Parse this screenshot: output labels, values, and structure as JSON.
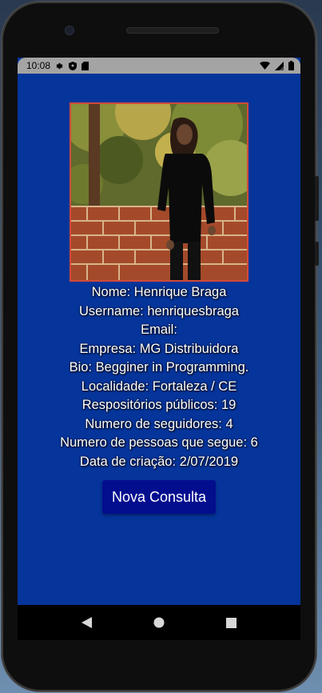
{
  "status_bar": {
    "time": "10:08",
    "left_icons": [
      "gear-icon",
      "shield-icon",
      "sd-card-icon"
    ],
    "right_icons": [
      "wifi-icon",
      "cellular-signal-icon",
      "battery-icon"
    ]
  },
  "profile": {
    "photo_icon": "profile-photo",
    "lines": [
      {
        "key": "name",
        "label": "Nome",
        "value": "Henrique Braga"
      },
      {
        "key": "username",
        "label": "Username",
        "value": "henriquesbraga"
      },
      {
        "key": "email",
        "label": "Email",
        "value": ""
      },
      {
        "key": "company",
        "label": "Empresa",
        "value": "MG Distribuidora"
      },
      {
        "key": "bio",
        "label": "Bio",
        "value": "Begginer in Programming."
      },
      {
        "key": "location",
        "label": "Localidade",
        "value": "Fortaleza / CE"
      },
      {
        "key": "public-repos",
        "label": "Respositórios públicos",
        "value": "19"
      },
      {
        "key": "followers",
        "label": "Numero de seguidores",
        "value": "4"
      },
      {
        "key": "following",
        "label": "Numero de pessoas que segue",
        "value": "6"
      },
      {
        "key": "created-at",
        "label": "Data de criação",
        "value": "2/07/2019"
      }
    ]
  },
  "actions": {
    "new_query_label": "Nova Consulta"
  },
  "nav_bar": {
    "buttons": [
      "back-icon",
      "home-icon",
      "recents-icon"
    ]
  },
  "colors": {
    "screen_background": "#05349a",
    "button_background": "#030e8f",
    "status_bar": "#a4a4a4",
    "avatar_border": "#d04a3a",
    "text": "#ffffff"
  }
}
